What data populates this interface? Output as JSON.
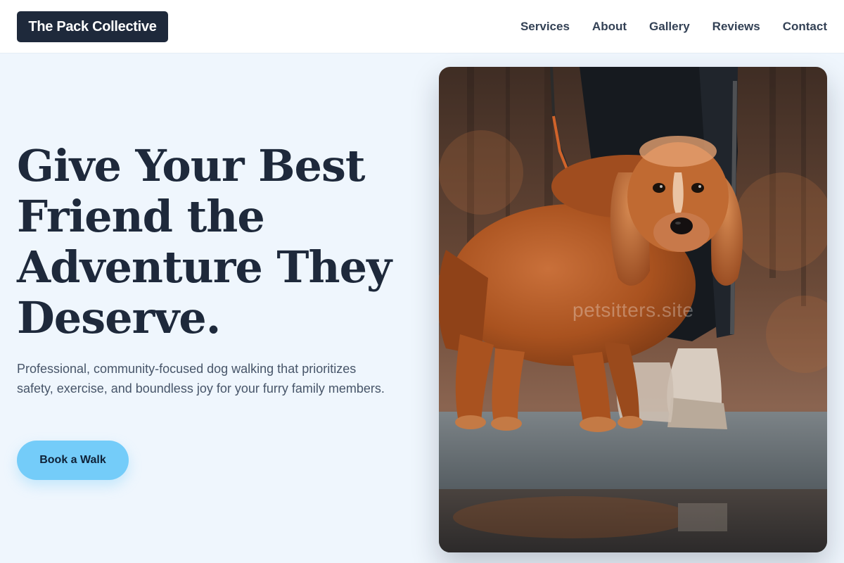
{
  "header": {
    "logo": "The Pack Collective",
    "nav": [
      "Services",
      "About",
      "Gallery",
      "Reviews",
      "Contact"
    ]
  },
  "hero": {
    "headline": [
      "Give Your Best",
      "Friend the",
      "Adventure They",
      "Deserve."
    ],
    "subtext": "Professional, community-focused dog walking that prioritizes safety, exercise, and boundless joy for your furry family members.",
    "cta_label": "Book a Walk"
  },
  "image": {
    "watermark": "petsitters.site"
  },
  "colors": {
    "page_bg": "#eff6fd",
    "header_bg": "#ffffff",
    "logo_bg": "#1e293b",
    "text_dark": "#1e293b",
    "text_muted": "#475569",
    "nav_text": "#334155",
    "cta_bg": "#74ccf9"
  }
}
